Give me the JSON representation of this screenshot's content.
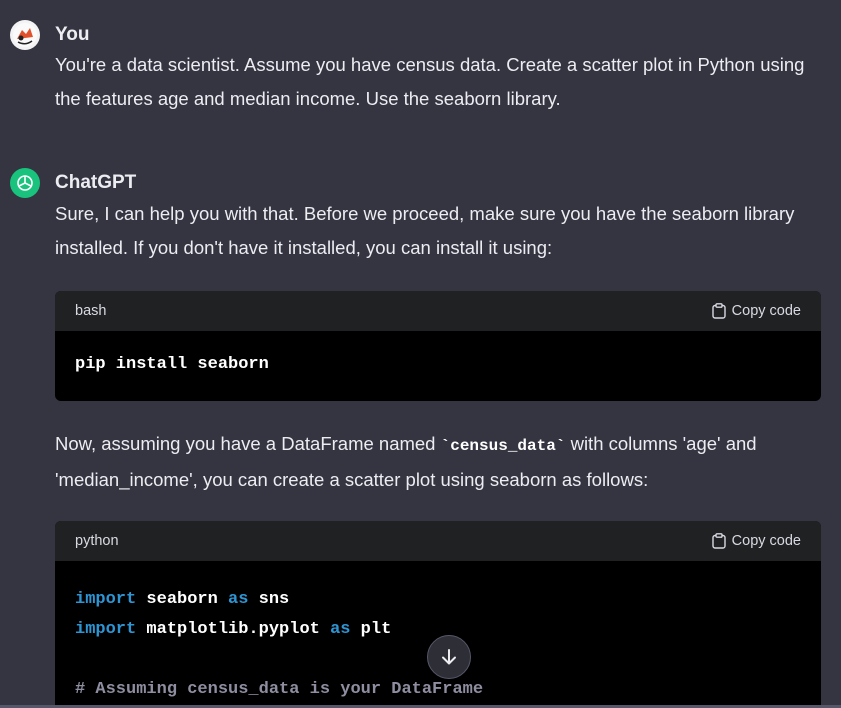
{
  "user_message": {
    "author": "You",
    "text": "You're a data scientist. Assume you have census data. Create a scatter plot in Python using the features age and median income. Use the seaborn library."
  },
  "assistant_message": {
    "author": "ChatGPT",
    "intro": "Sure, I can help you with that. Before we proceed, make sure you have the seaborn library installed. If you don't have it installed, you can install it using:",
    "code_block_1": {
      "language": "bash",
      "copy_label": "Copy code",
      "lines": [
        "pip install seaborn"
      ]
    },
    "middle": {
      "before": "Now, assuming you have a DataFrame named ",
      "code": "`census_data`",
      "after": " with columns 'age' and 'median_income', you can create a scatter plot using seaborn as follows:"
    },
    "code_block_2": {
      "language": "python",
      "copy_label": "Copy code",
      "line1": {
        "kw1": "import",
        "mod": " seaborn ",
        "kw2": "as",
        "alias": " sns"
      },
      "line2": {
        "kw1": "import",
        "mod": " matplotlib.pyplot ",
        "kw2": "as",
        "alias": " plt"
      },
      "line3_comment": "# Assuming census_data is your DataFrame"
    }
  },
  "colors": {
    "background": "#343541",
    "code_background": "#000000",
    "keyword": "#2e95d3",
    "gpt_avatar": "#19c37d"
  },
  "icons": [
    "user-avatar-icon",
    "chatgpt-logo-icon",
    "clipboard-icon",
    "arrow-down-icon"
  ]
}
